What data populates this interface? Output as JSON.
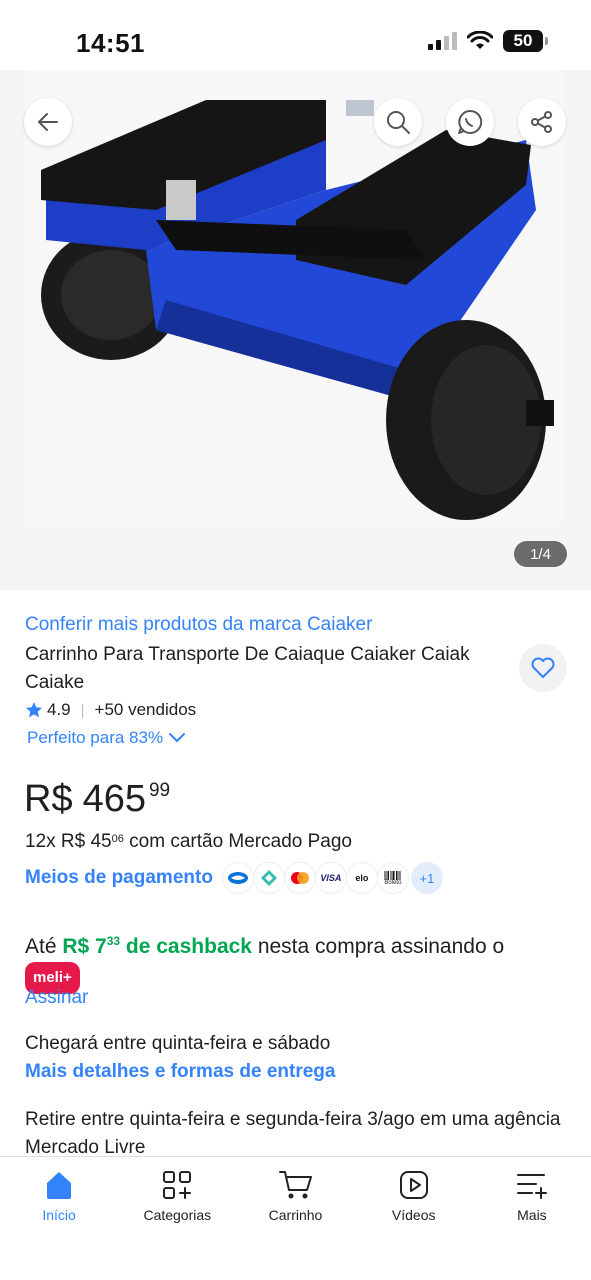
{
  "status_bar": {
    "time": "14:51",
    "battery": "50"
  },
  "gallery": {
    "pager": "1/4"
  },
  "product": {
    "brand_link": "Conferir mais produtos da marca Caiaker",
    "title": "Carrinho Para Transporte De Caiaque Caiaker Caiak Caiake",
    "rating": "4.9",
    "sold": "+50 vendidos",
    "fit": "Perfeito para 83%"
  },
  "price": {
    "currency": "R$",
    "integer": "465",
    "cents": "99",
    "installments_prefix": "12x R$ 45",
    "installments_cents": "06",
    "installments_suffix": " com cartão Mercado Pago",
    "payment_link": "Meios de pagamento",
    "payment_methods": [
      "Mercado Pago",
      "Pix",
      "Mastercard",
      "VISA",
      "elo",
      "Boleto"
    ],
    "payment_more": "+1"
  },
  "cashback": {
    "prefix": "Até ",
    "amount": "R$ 7",
    "amount_cents": "33",
    "label": " de cashback",
    "suffix": " nesta compra assinando o ",
    "badge": "meli+",
    "subscribe": "Assinar"
  },
  "delivery": {
    "text": "Chegará entre quinta-feira e sábado",
    "link": "Mais detalhes e formas de entrega",
    "pickup": "Retire entre quinta-feira e segunda-feira 3/ago em uma agência Mercado Livre"
  },
  "nav": {
    "items": [
      {
        "label": "Início"
      },
      {
        "label": "Categorias"
      },
      {
        "label": "Carrinho"
      },
      {
        "label": "Vídeos"
      },
      {
        "label": "Mais"
      }
    ]
  },
  "colors": {
    "accent": "#3483fa",
    "green": "#00a650",
    "meli": "#e6194b"
  }
}
